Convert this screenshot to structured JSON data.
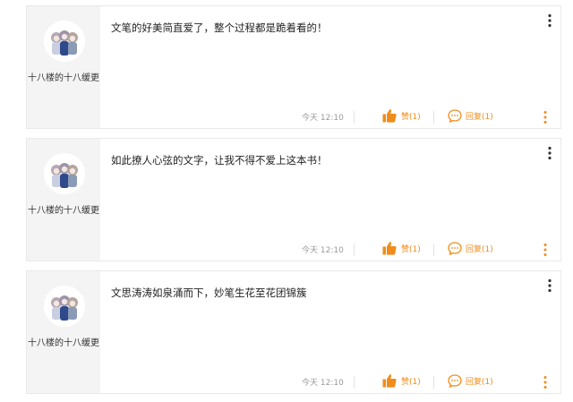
{
  "comments": [
    {
      "username": "十八楼的十八缓更",
      "text": "文笔的好美简直爱了，整个过程都是跪着看的！",
      "time": "今天 12:10",
      "like_label": "赞(1)",
      "reply_label": "回复(1)"
    },
    {
      "username": "十八楼的十八缓更",
      "text": "如此撩人心弦的文字，让我不得不爱上这本书！",
      "time": "今天 12:10",
      "like_label": "赞(1)",
      "reply_label": "回复(1)"
    },
    {
      "username": "十八楼的十八缓更",
      "text": "文思涛涛如泉涌而下，妙笔生花至花团锦簇",
      "time": "今天 12:10",
      "like_label": "赞(1)",
      "reply_label": "回复(1)"
    }
  ],
  "icons": {
    "avatar": "avatar-illustration",
    "like": "thumbs-up-icon",
    "reply": "comment-bubble-icon",
    "more": "vertical-dots-icon"
  },
  "colors": {
    "accent": "#f08c1a",
    "text": "#222222",
    "muted": "#999999",
    "sidebar_bg": "#f4f4f4",
    "border": "#e9e9e9"
  }
}
